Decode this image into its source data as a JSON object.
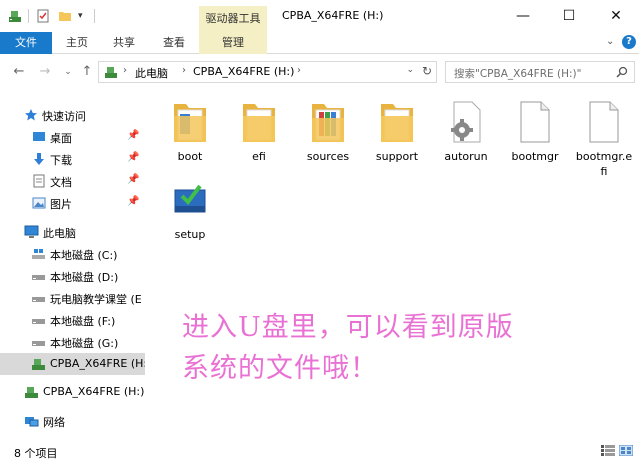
{
  "titlebar": {
    "context_tab": "驱动器工具",
    "window_title": "CPBA_X64FRE (H:)",
    "minimize": "—",
    "maximize": "☐",
    "close": "✕"
  },
  "ribbon": {
    "tabs": [
      "文件",
      "主页",
      "共享",
      "查看"
    ],
    "manage_tab": "管理",
    "collapse_glyph": "⌄",
    "help_glyph": "?"
  },
  "address": {
    "crumbs": [
      "此电脑",
      "CPBA_X64FRE (H:)"
    ],
    "separator": "›",
    "search_placeholder": "搜索\"CPBA_X64FRE (H:)\""
  },
  "nav": {
    "quick_access": "快速访问",
    "pinned": [
      {
        "label": "桌面",
        "icon": "desktop-icon"
      },
      {
        "label": "下载",
        "icon": "download-icon"
      },
      {
        "label": "文档",
        "icon": "documents-icon"
      },
      {
        "label": "图片",
        "icon": "pictures-icon"
      }
    ],
    "this_pc": "此电脑",
    "drives": [
      "本地磁盘 (C:)",
      "本地磁盘 (D:)",
      "玩电脑教学课堂 (E",
      "本地磁盘 (F:)",
      "本地磁盘 (G:)",
      "CPBA_X64FRE (H:"
    ],
    "usb_drive": "CPBA_X64FRE (H:)",
    "network": "网络"
  },
  "files": [
    {
      "name": "boot",
      "type": "folder"
    },
    {
      "name": "efi",
      "type": "folder"
    },
    {
      "name": "sources",
      "type": "folder-color"
    },
    {
      "name": "support",
      "type": "folder"
    },
    {
      "name": "autorun",
      "type": "settings-file"
    },
    {
      "name": "bootmgr",
      "type": "blank-file"
    },
    {
      "name": "bootmgr.efi",
      "type": "blank-file"
    },
    {
      "name": "setup",
      "type": "setup-exe"
    }
  ],
  "caption": {
    "line1": "进入U盘里，可以看到原版",
    "line2": "系统的文件哦！"
  },
  "status": {
    "item_count": "8 个项目"
  },
  "colors": {
    "accent": "#1979ca",
    "context_tab_bg": "#f4efc4",
    "folder": "#f5c65a",
    "caption": "#ea71d4",
    "selected_nav": "#d9d9d9"
  }
}
